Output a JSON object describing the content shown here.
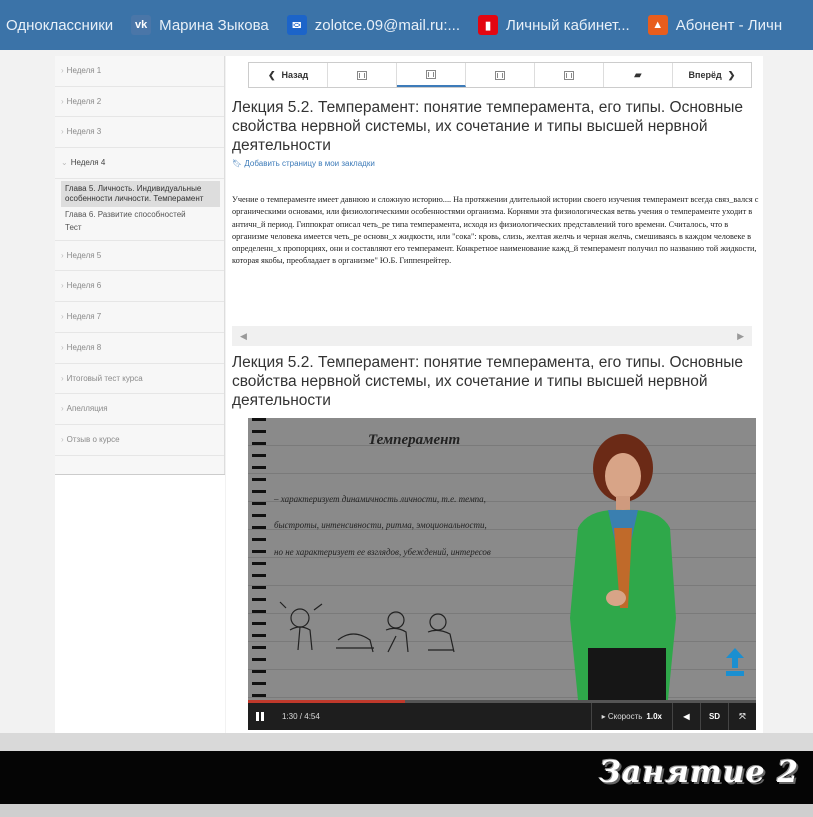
{
  "bookmarks": [
    {
      "label": "Одноклассники",
      "icon": "odnoklassniki-icon",
      "color": ""
    },
    {
      "label": "Марина Зыкова",
      "icon": "vk-icon",
      "color": "#4a76a8"
    },
    {
      "label": "zolotce.09@mail.ru:...",
      "icon": "mail-icon",
      "color": "#1c64c9"
    },
    {
      "label": "Личный кабинет...",
      "icon": "mts-icon",
      "color": "#e30611"
    },
    {
      "label": "Абонент - Личн",
      "icon": "beeline-icon",
      "color": "#e85d1c"
    }
  ],
  "sidebar": {
    "weeks_before": [
      "Неделя 1",
      "Неделя 2",
      "Неделя 3"
    ],
    "open_week": "Неделя 4",
    "chapters": [
      "Глава 5. Личность. Индивидуальные особенности личности. Темперамент",
      "Глава 6. Развитие способностей",
      "Тест"
    ],
    "weeks_after": [
      "Неделя 5",
      "Неделя 6",
      "Неделя 7",
      "Неделя 8",
      "Итоговый тест курса",
      "Апелляция",
      "Отзыв о курсе"
    ]
  },
  "nav": {
    "back": "Назад",
    "forward": "Вперёд"
  },
  "lecture": {
    "title": "Лекция 5.2. Темперамент: понятие темперамента, его типы. Основные свойства нервной системы, их сочетание и типы высшей нервной деятельности",
    "bookmark_link": "Добавить страницу в мои закладки",
    "body": "Учение о темпераменте имеет давнюю и сложную историю.... На протяжении длительной истории своего изучения темперамент всегда связ_вался с органическими основами, или физиологическими особенностями организма. Корнями эта физиологическая ветвь учения о темпераменте уходит в античн_й период. Гиппократ описал четь_ре типа темперамента, исходя из физиологических представлений того времени. Считалось, что в организме человека имеется четь_ре основн_х жидкости, или \"сока\": кровь, слизь, желтая желчь и черная желчь, смешиваясь в каждом человеке в определенн_х пропорциях, они и составляют его темперамент. Конкретное наименование кажд_й темперамент получил по названию той жидкости, которая якобы, преобладает в организме\" Ю.Б. Гиппенрейтер.",
    "title2": "Лекция 5.2. Темперамент: понятие темперамента, его типы. Основные свойства нервной системы, их сочетание и типы высшей нервной деятельности"
  },
  "video": {
    "board_title": "Темперамент",
    "board_lines": [
      "– характеризует динамичность личности, т.е. темпа,",
      "быстроты, интенсивности, ритма, эмоциональности,",
      "но не характеризует ее взглядов, убеждений, интересов"
    ],
    "time": "1:30 / 4:54",
    "progress": 0.31,
    "speed_label": "▸ Скорость",
    "speed_value": "1.0x",
    "quality": "SD"
  },
  "banner": "Занятие 2"
}
